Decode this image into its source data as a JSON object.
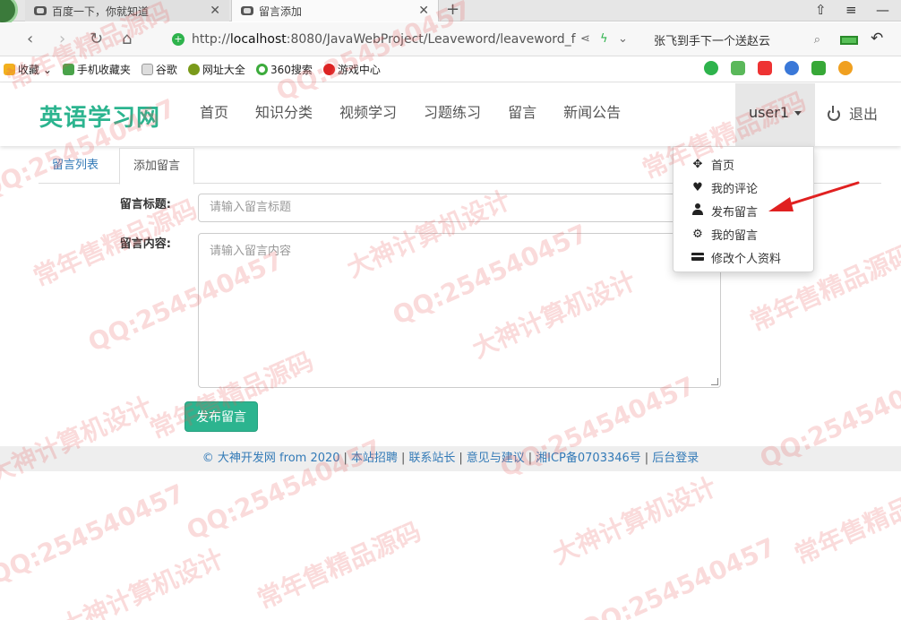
{
  "browser": {
    "tabs": [
      {
        "title": "百度一下，你就知道",
        "active": false
      },
      {
        "title": "留言添加",
        "active": true
      }
    ],
    "new_tab_label": "+",
    "url_prefix": "http://",
    "url_host": "localhost",
    "url_rest": ":8080/JavaWebProject/Leaveword/leaveword_f",
    "search_text": "张飞到手下一个送赵云",
    "bookmarks": [
      "收藏",
      "手机收藏夹",
      "谷歌",
      "网址大全",
      "360搜索",
      "游戏中心"
    ]
  },
  "site": {
    "logo": "英语学习网",
    "nav": [
      "首页",
      "知识分类",
      "视频学习",
      "习题练习",
      "留言",
      "新闻公告"
    ],
    "user_name": "user1",
    "logout_label": "退出"
  },
  "dropdown": {
    "items": [
      {
        "label": "首页",
        "icon": "move-icon"
      },
      {
        "label": "我的评论",
        "icon": "heart-icon"
      },
      {
        "label": "发布留言",
        "icon": "user-icon"
      },
      {
        "label": "我的留言",
        "icon": "cog-icon"
      },
      {
        "label": "修改个人资料",
        "icon": "credit-card-icon"
      }
    ]
  },
  "content": {
    "tabs": [
      "留言列表",
      "添加留言"
    ],
    "active_tab": 1,
    "title_label": "留言标题:",
    "title_placeholder": "请输入留言标题",
    "content_label": "留言内容:",
    "content_placeholder": "请输入留言内容",
    "submit_label": "发布留言"
  },
  "footer": {
    "links": [
      "© 大神开发网 from 2020",
      "本站招聘",
      "联系站长",
      "意见与建议",
      "湘ICP备0703346号",
      "后台登录"
    ],
    "separator": "|"
  },
  "watermark": {
    "texts": [
      "QQ:254540457",
      "常年售精品源码",
      "大神计算机设计"
    ]
  },
  "colors": {
    "accent": "#2cb48f",
    "link": "#337ab7",
    "annotation_arrow": "#e02020"
  }
}
